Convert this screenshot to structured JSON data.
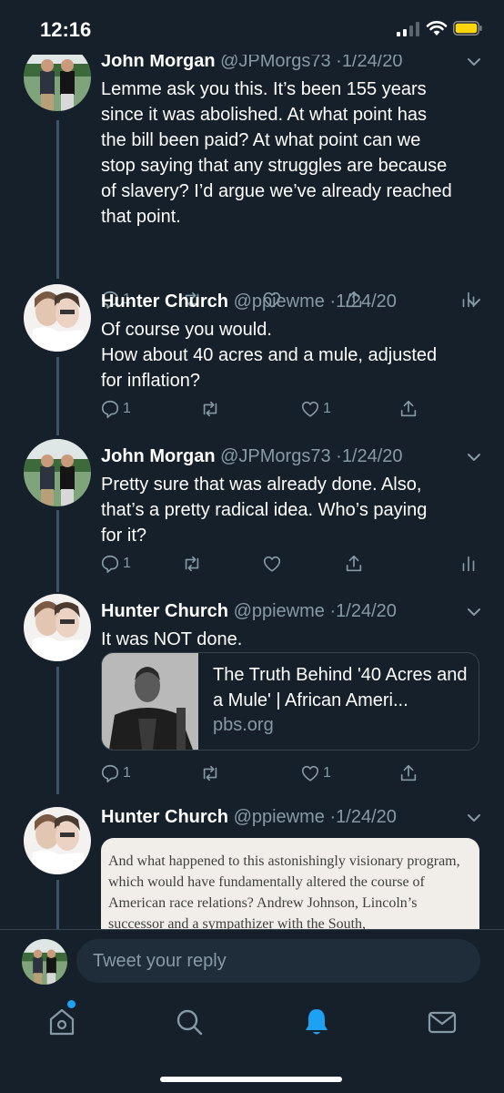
{
  "status_bar": {
    "time": "12:16"
  },
  "tweets": [
    {
      "name": "John Morgan",
      "handle": "@JPMorgs73",
      "date": "1/24/20",
      "text": "Lemme ask you this. It’s been 155 years\nsince it was abolished. At what point has\nthe bill been paid? At what point can we\nstop saying that any struggles are because\nof slavery? I’d argue we’ve already reached\nthat point.",
      "reply_count": "1",
      "like_count": ""
    },
    {
      "name": "Hunter Church",
      "handle": "@ppiewme",
      "date": "1/24/20",
      "text": "Of course you would.\nHow about 40 acres and a mule, adjusted\nfor inflation?",
      "reply_count": "1",
      "like_count": "1"
    },
    {
      "name": "John Morgan",
      "handle": "@JPMorgs73",
      "date": "1/24/20",
      "text": "Pretty sure that was already done. Also,\nthat’s a pretty radical idea. Who’s paying\nfor it?",
      "reply_count": "1",
      "like_count": ""
    },
    {
      "name": "Hunter Church",
      "handle": "@ppiewme",
      "date": "1/24/20",
      "text": "It was NOT done.",
      "reply_count": "1",
      "like_count": "1",
      "card": {
        "title": "The Truth Behind '40 Acres and a Mule' | African Ameri...",
        "domain": "pbs.org"
      }
    },
    {
      "name": "Hunter Church",
      "handle": "@ppiewme",
      "date": "1/24/20",
      "image_text": "And what happened to this astonishingly visionary program, which would have fundamentally altered the course of American race relations? Andrew Johnson, Lincoln’s successor and a sympathizer with the South,"
    }
  ],
  "reply_bar": {
    "placeholder": "Tweet your reply"
  },
  "tab_bar": {
    "tabs": [
      "home-icon",
      "search-icon",
      "notifications-icon",
      "messages-icon"
    ],
    "active_color": "#1da1f2"
  },
  "colors": {
    "background": "#15202b",
    "secondary_text": "#8899a6",
    "divider": "#38444d",
    "accent": "#1da1f2",
    "battery": "#ffd60a"
  }
}
